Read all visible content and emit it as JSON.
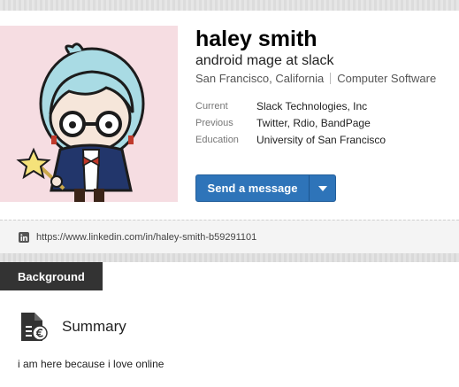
{
  "profile": {
    "name": "haley smith",
    "headline": "android mage at slack",
    "location": "San Francisco, California",
    "industry": "Computer Software",
    "facts": [
      {
        "label": "Current",
        "value": "Slack Technologies, Inc"
      },
      {
        "label": "Previous",
        "value": "Twitter, Rdio, BandPage"
      },
      {
        "label": "Education",
        "value": "University of San Francisco"
      }
    ]
  },
  "actions": {
    "send_message_label": "Send a message",
    "menu_icon": "chevron-down-icon"
  },
  "public_profile": {
    "icon": "linkedin-icon",
    "url": "https://www.linkedin.com/in/haley-smith-b59291101"
  },
  "sections": {
    "background_tab": "Background",
    "summary": {
      "icon": "summary-document-icon",
      "title": "Summary",
      "text": "i am here because i love online"
    }
  },
  "colors": {
    "primary_button": "#2e74b9",
    "avatar_background": "#f6dde2",
    "section_tab": "#333333"
  }
}
